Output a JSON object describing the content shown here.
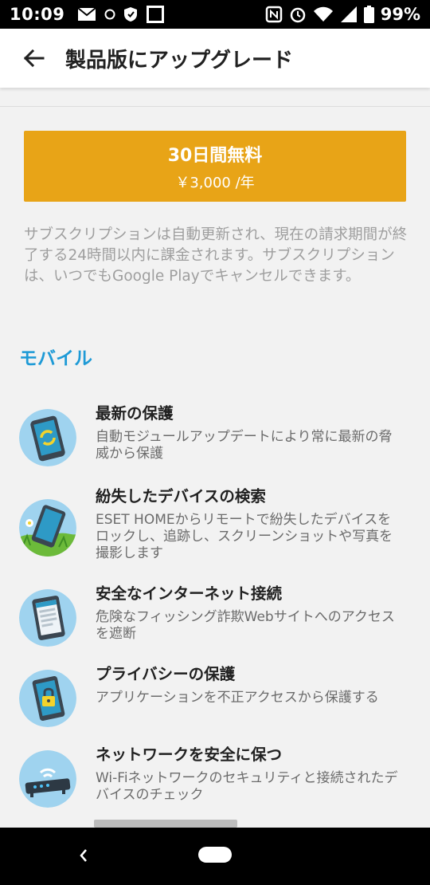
{
  "status_bar": {
    "time": "10:09",
    "battery": "99%",
    "icons_left": [
      "mail-icon",
      "at-icon",
      "shield-icon",
      "notification-icon"
    ],
    "icons_right": [
      "nfc-icon",
      "alarm-icon",
      "wifi-icon",
      "signal-icon",
      "battery-icon"
    ]
  },
  "app_bar": {
    "title": "製品版にアップグレード"
  },
  "offer": {
    "title": "30日間無料",
    "price": "￥3,000 /年",
    "color": "#e8a417"
  },
  "subscription_note": "サブスクリプションは自動更新され、現在の請求期間が終了する24時間以内に課金されます。サブスクリプションは、いつでもGoogle Playでキャンセルできます。",
  "section": {
    "title": "モバイル",
    "color": "#1e9ad6"
  },
  "features": [
    {
      "title": "最新の保護",
      "desc": "自動モジュールアップデートにより常に最新の脅威から保護",
      "icon": "update-phone-icon"
    },
    {
      "title": "紛失したデバイスの検索",
      "desc": "ESET HOMEからリモートで紛失したデバイスをロックし、追跡し、スクリーンショットや写真を撮影します",
      "icon": "lost-phone-icon"
    },
    {
      "title": "安全なインターネット接続",
      "desc": "危険なフィッシング詐欺Webサイトへのアクセスを遮断",
      "icon": "browser-phone-icon"
    },
    {
      "title": "プライバシーの保護",
      "desc": "アプリケーションを不正アクセスから保護する",
      "icon": "lock-phone-icon"
    },
    {
      "title": "ネットワークを安全に保つ",
      "desc": "Wi-Fiネットワークのセキュリティと接続されたデバイスのチェック",
      "icon": "router-icon"
    }
  ]
}
